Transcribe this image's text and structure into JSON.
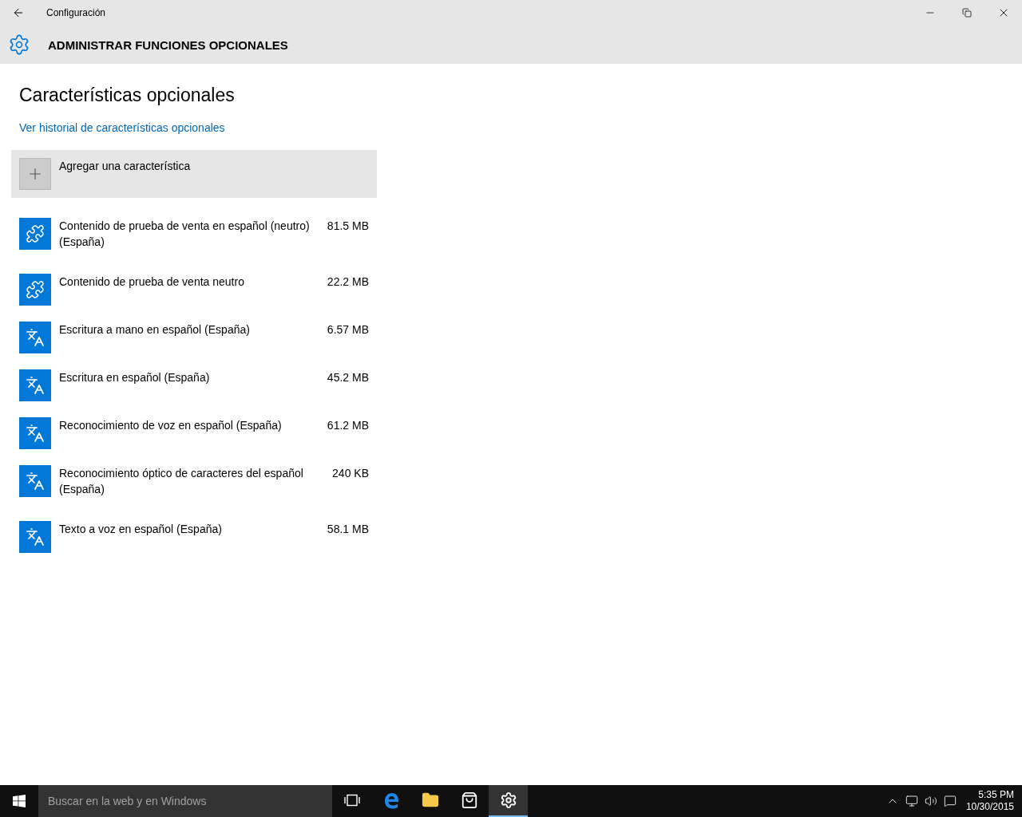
{
  "window": {
    "title": "Configuración"
  },
  "header": {
    "title": "ADMINISTRAR FUNCIONES OPCIONALES"
  },
  "page": {
    "title": "Características opcionales",
    "history_link": "Ver historial de características opcionales",
    "add_button": "Agregar una característica"
  },
  "features": [
    {
      "kind": "puzzle",
      "name": "Contenido de prueba de venta en español (neutro) (España)",
      "size": "81.5 MB"
    },
    {
      "kind": "puzzle",
      "name": "Contenido de prueba de venta neutro",
      "size": "22.2 MB"
    },
    {
      "kind": "language",
      "name": "Escritura a mano en español (España)",
      "size": "6.57 MB"
    },
    {
      "kind": "language",
      "name": "Escritura en español (España)",
      "size": "45.2 MB"
    },
    {
      "kind": "language",
      "name": "Reconocimiento de voz en español (España)",
      "size": "61.2 MB"
    },
    {
      "kind": "language",
      "name": "Reconocimiento óptico de caracteres del español (España)",
      "size": "240 KB"
    },
    {
      "kind": "language",
      "name": "Texto a voz en español (España)",
      "size": "58.1 MB"
    }
  ],
  "taskbar": {
    "search": {
      "placeholder": "Buscar en la web y en Windows"
    },
    "apps": [
      {
        "kind": "task-view",
        "selected": false
      },
      {
        "kind": "browser",
        "selected": false
      },
      {
        "kind": "folder",
        "selected": false
      },
      {
        "kind": "store",
        "selected": false
      },
      {
        "kind": "settings",
        "selected": true
      }
    ],
    "clock": {
      "time": "5:35 PM",
      "date": "10/30/2015"
    }
  }
}
